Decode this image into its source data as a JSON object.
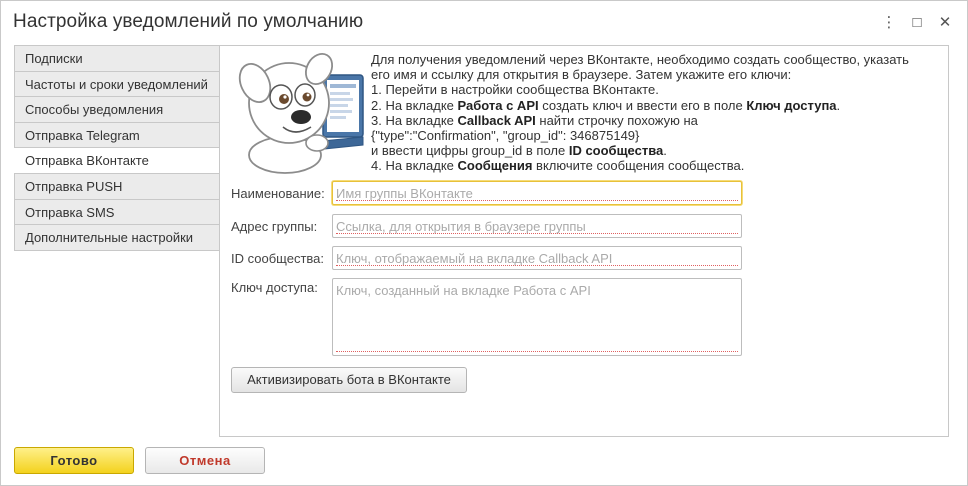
{
  "window": {
    "title": "Настройка уведомлений по умолчанию",
    "controls": {
      "more_icon": "⋮",
      "maximize_icon": "□",
      "close_icon": "✕"
    }
  },
  "nav": {
    "items": [
      {
        "label": "Подписки",
        "active": false
      },
      {
        "label": "Частоты и сроки уведомлений",
        "active": false
      },
      {
        "label": "Способы уведомления",
        "active": false
      },
      {
        "label": "Отправка Telegram",
        "active": false
      },
      {
        "label": "Отправка ВКонтакте",
        "active": true
      },
      {
        "label": "Отправка PUSH",
        "active": false
      },
      {
        "label": "Отправка SMS",
        "active": false
      },
      {
        "label": "Дополнительные настройки",
        "active": false
      }
    ]
  },
  "info": {
    "line1": "Для получения уведомлений через ВКонтакте, необходимо создать сообщество, указать",
    "line2": "его имя и ссылку для открытия в браузере. Затем укажите его ключи:",
    "line3": "1. Перейти в настройки сообщества ВКонтакте.",
    "line4_a": "2. На вкладке ",
    "line4_b": "Работа с API",
    "line4_c": " создать ключ и ввести его в поле ",
    "line4_d": "Ключ доступа",
    "line4_e": ".",
    "line5_a": "3. На вкладке ",
    "line5_b": "Callback API",
    "line5_c": " найти строчку похожую на",
    "line6": "{\"type\":\"Confirmation\", \"group_id\": 346875149}",
    "line7_a": "и ввести цифры group_id в поле ",
    "line7_b": "ID сообщества",
    "line7_c": ".",
    "line8_a": "4. На вкладке ",
    "line8_b": "Сообщения",
    "line8_c": " включите сообщения сообщества."
  },
  "form": {
    "name": {
      "label": "Наименование:",
      "placeholder": "Имя группы ВКонтакте",
      "value": ""
    },
    "address": {
      "label": "Адрес группы:",
      "placeholder": "Ссылка, для открытия в браузере группы",
      "value": ""
    },
    "group_id": {
      "label": "ID сообщества:",
      "placeholder": "Ключ, отображаемый на вкладке Callback API",
      "value": ""
    },
    "access_key": {
      "label": "Ключ доступа:",
      "placeholder": "Ключ, созданный на вкладке Работа с API",
      "value": ""
    }
  },
  "buttons": {
    "activate": "Активизировать бота в ВКонтакте",
    "ok": "Готово",
    "cancel": "Отмена"
  },
  "colors": {
    "ok_button": "#f3d21e",
    "cancel_text": "#c0392b",
    "focus_border": "#e8c13a",
    "required_underline": "#e06060"
  }
}
